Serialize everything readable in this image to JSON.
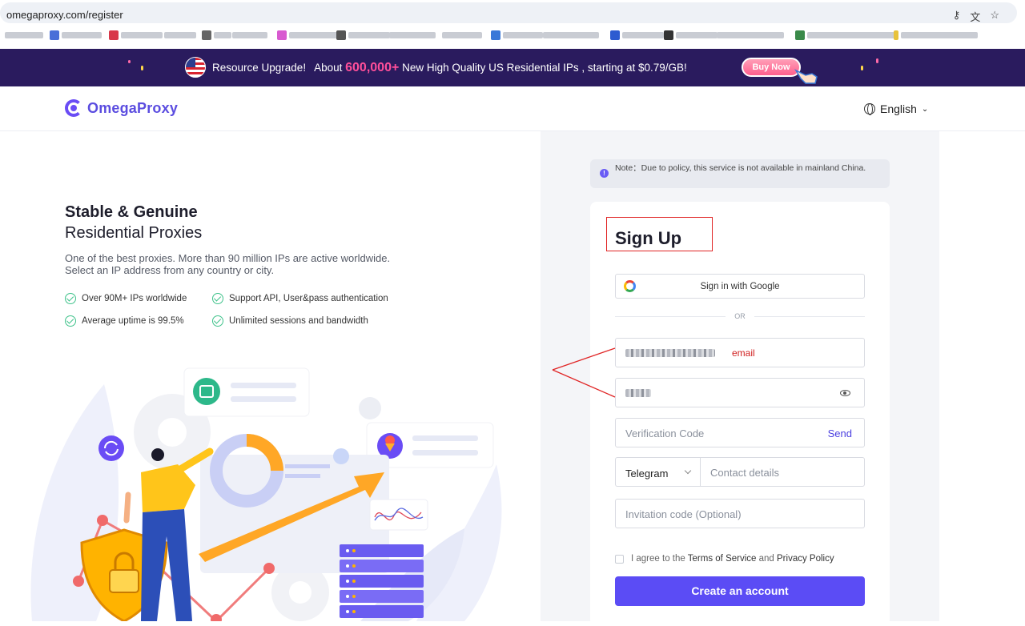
{
  "browser": {
    "url": "omegaproxy.com/register",
    "icons": [
      "key-icon",
      "translate-icon",
      "star-icon"
    ]
  },
  "banner": {
    "prefix": "Resource Upgrade!",
    "about": "About",
    "highlight": "600,000+",
    "suffix": "New High Quality US Residential IPs , starting at $0.79/GB!",
    "button": "Buy Now",
    "highlight_color": "#ff4f9a",
    "background": "#2a1b5e"
  },
  "header": {
    "brand": "OmegaProxy",
    "language": "English"
  },
  "hero": {
    "title_line1": "Stable & Genuine",
    "title_line2": "Residential Proxies",
    "desc_line1": "One of the best proxies. More than 90 million IPs are active worldwide.",
    "desc_line2": "Select an IP address from any country or city.",
    "features": [
      "Over 90M+ IPs worldwide",
      "Support API, User&pass authentication",
      "Average uptime is 99.5%",
      "Unlimited sessions and bandwidth"
    ]
  },
  "note": {
    "text": "Note：Due to policy, this service is not available in mainland China."
  },
  "form": {
    "title": "Sign Up",
    "google_label": "Sign in with Google",
    "or": "OR",
    "email_annotation": "email",
    "verification_placeholder": "Verification Code",
    "send_label": "Send",
    "contact_type": "Telegram",
    "contact_placeholder": "Contact details",
    "invitation_placeholder": "Invitation code (Optional)",
    "agree_prefix": "I agree to the",
    "terms": "Terms of Service",
    "and": "and",
    "privacy": "Privacy Policy",
    "submit": "Create an account",
    "accent_color": "#5b4cf5"
  }
}
